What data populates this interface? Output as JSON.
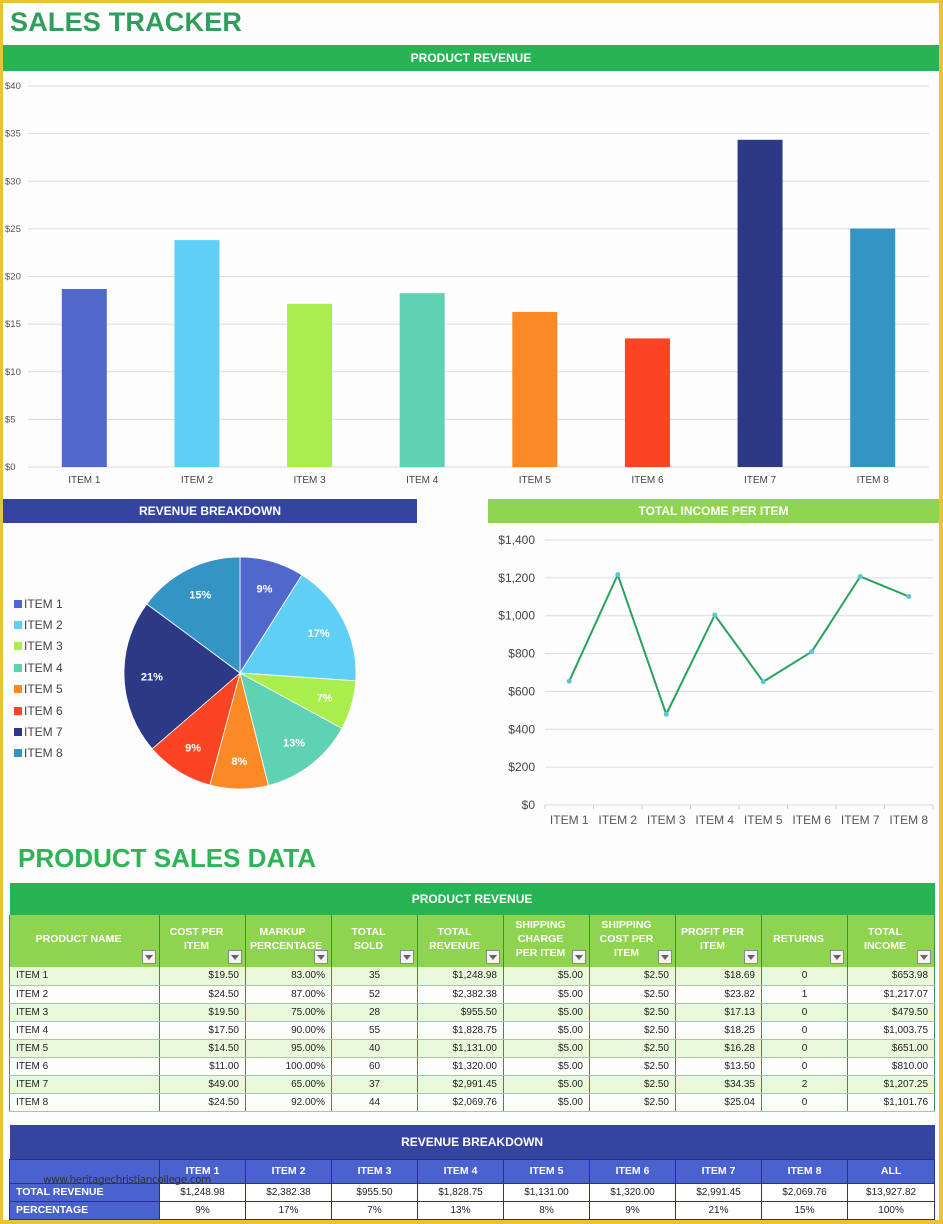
{
  "page": {
    "title": "SALES TRACKER",
    "section_title": "PRODUCT SALES DATA",
    "watermark": "www.heritagechristiancollege.com"
  },
  "colors": {
    "title_green": "#2f9e5a",
    "banner_green": "#27b454",
    "banner_lime": "#8fd450",
    "banner_navy": "#3444a0",
    "table_header_blue": "#4a62cf",
    "frame_gold": "#e6c33a",
    "line_color": "#2aa25c",
    "marker_color": "#5bc6d8"
  },
  "item_colors": [
    "#5068cc",
    "#5fcff6",
    "#aaee4e",
    "#5fd2b4",
    "#fb8a26",
    "#fb4423",
    "#2c3a85",
    "#3494c6"
  ],
  "chart_data": [
    {
      "type": "bar",
      "title": "PRODUCT REVENUE",
      "categories": [
        "ITEM 1",
        "ITEM 2",
        "ITEM 3",
        "ITEM 4",
        "ITEM 5",
        "ITEM 6",
        "ITEM 7",
        "ITEM 8"
      ],
      "values": [
        18.69,
        23.82,
        17.13,
        18.25,
        16.28,
        13.5,
        34.35,
        25.04
      ],
      "yticks": [
        "$0",
        "$5",
        "$10",
        "$15",
        "$20",
        "$25",
        "$30",
        "$35",
        "$40"
      ],
      "ylim": [
        0,
        40
      ],
      "xlabel": "",
      "ylabel": "",
      "grid": true
    },
    {
      "type": "pie",
      "title": "REVENUE BREAKDOWN",
      "categories": [
        "ITEM 1",
        "ITEM 2",
        "ITEM 3",
        "ITEM 4",
        "ITEM 5",
        "ITEM 6",
        "ITEM 7",
        "ITEM 8"
      ],
      "values": [
        1248.98,
        2382.38,
        955.5,
        1828.75,
        1131.0,
        1320.0,
        2991.45,
        2069.76
      ],
      "labels": [
        "9%",
        "17%",
        "7%",
        "13%",
        "8%",
        "9%",
        "21%",
        "15%"
      ],
      "legend": "left"
    },
    {
      "type": "line",
      "title": "TOTAL INCOME PER ITEM",
      "categories": [
        "ITEM 1",
        "ITEM 2",
        "ITEM 3",
        "ITEM 4",
        "ITEM 5",
        "ITEM 6",
        "ITEM 7",
        "ITEM 8"
      ],
      "values": [
        653.98,
        1217.07,
        479.5,
        1003.75,
        651.0,
        810.0,
        1207.25,
        1101.76
      ],
      "yticks": [
        "$0",
        "$200",
        "$400",
        "$600",
        "$800",
        "$1,000",
        "$1,200",
        "$1,400"
      ],
      "ylim": [
        0,
        1400
      ],
      "grid": true
    }
  ],
  "sales_table": {
    "banner": "PRODUCT REVENUE",
    "headers": [
      "PRODUCT NAME",
      "COST PER ITEM",
      "MARKUP PERCENTAGE",
      "TOTAL SOLD",
      "TOTAL REVENUE",
      "SHIPPING CHARGE PER ITEM",
      "SHIPPING COST PER ITEM",
      "PROFIT PER ITEM",
      "RETURNS",
      "TOTAL INCOME"
    ],
    "rows": [
      [
        "ITEM 1",
        "$19.50",
        "83.00%",
        "35",
        "$1,248.98",
        "$5.00",
        "$2.50",
        "$18.69",
        "0",
        "$653.98"
      ],
      [
        "ITEM 2",
        "$24.50",
        "87.00%",
        "52",
        "$2,382.38",
        "$5.00",
        "$2.50",
        "$23.82",
        "1",
        "$1,217.07"
      ],
      [
        "ITEM 3",
        "$19.50",
        "75.00%",
        "28",
        "$955.50",
        "$5.00",
        "$2.50",
        "$17.13",
        "0",
        "$479.50"
      ],
      [
        "ITEM 4",
        "$17.50",
        "90.00%",
        "55",
        "$1,828.75",
        "$5.00",
        "$2.50",
        "$18.25",
        "0",
        "$1,003.75"
      ],
      [
        "ITEM 5",
        "$14.50",
        "95.00%",
        "40",
        "$1,131.00",
        "$5.00",
        "$2.50",
        "$16.28",
        "0",
        "$651.00"
      ],
      [
        "ITEM 6",
        "$11.00",
        "100.00%",
        "60",
        "$1,320.00",
        "$5.00",
        "$2.50",
        "$13.50",
        "0",
        "$810.00"
      ],
      [
        "ITEM 7",
        "$49.00",
        "65.00%",
        "37",
        "$2,991.45",
        "$5.00",
        "$2.50",
        "$34.35",
        "2",
        "$1,207.25"
      ],
      [
        "ITEM 8",
        "$24.50",
        "92.00%",
        "44",
        "$2,069.76",
        "$5.00",
        "$2.50",
        "$25.04",
        "0",
        "$1,101.76"
      ]
    ]
  },
  "revenue_table": {
    "banner": "REVENUE BREAKDOWN",
    "headers": [
      "ITEM 1",
      "ITEM 2",
      "ITEM 3",
      "ITEM 4",
      "ITEM 5",
      "ITEM 6",
      "ITEM 7",
      "ITEM 8",
      "ALL"
    ],
    "rows": [
      {
        "label": "TOTAL REVENUE",
        "values": [
          "$1,248.98",
          "$2,382.38",
          "$955.50",
          "$1,828.75",
          "$1,131.00",
          "$1,320.00",
          "$2,991.45",
          "$2,069.76",
          "$13,927.82"
        ]
      },
      {
        "label": "PERCENTAGE",
        "values": [
          "9%",
          "17%",
          "7%",
          "13%",
          "8%",
          "9%",
          "21%",
          "15%",
          "100%"
        ]
      }
    ]
  }
}
